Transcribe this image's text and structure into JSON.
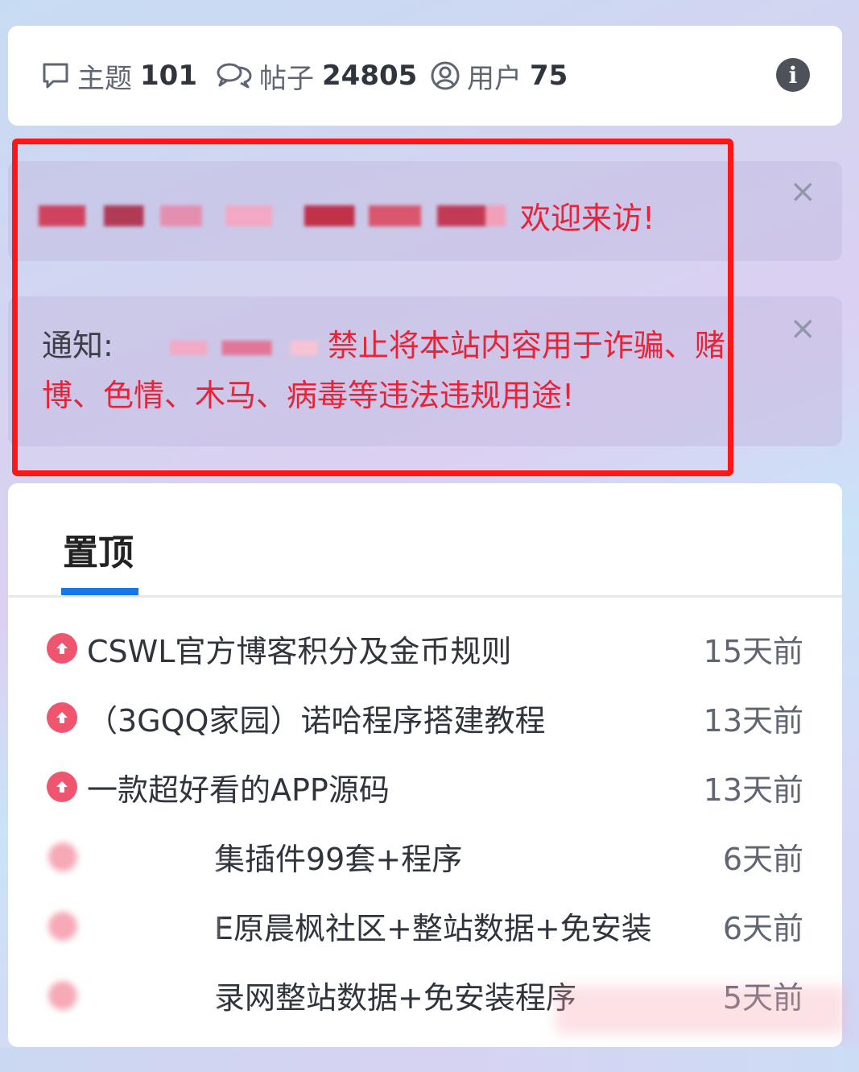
{
  "stats": {
    "topics_label": "主题",
    "topics_value": "101",
    "posts_label": "帖子",
    "posts_value": "24805",
    "users_label": "用户",
    "users_value": "75",
    "info_icon": "i"
  },
  "notices": {
    "welcome_text": "欢迎来访!",
    "rules_label": "通知:",
    "rules_text": "禁止将本站内容用于诈骗、赌博、色情、木马、病毒等违法违规用途!",
    "close_glyph": "×"
  },
  "pinned": {
    "tab_label": "置顶",
    "items": [
      {
        "title": "CSWL官方博客积分及金币规则",
        "time": "15天前"
      },
      {
        "title": "（3GQQ家园）诺哈程序搭建教程",
        "time": "13天前"
      },
      {
        "title": "一款超好看的APP源码",
        "time": "13天前"
      },
      {
        "title": "集插件99套+程序",
        "time": "6天前"
      },
      {
        "title": "E原晨枫社区+整站数据+免安装",
        "time": "6天前"
      },
      {
        "title": "录网整站数据+免安装程序",
        "time": "5天前"
      }
    ]
  },
  "colors": {
    "accent": "#1877e8",
    "notice_red": "#e5243a",
    "pin_pink": "#f0556f",
    "highlight_red": "#ff1717"
  }
}
